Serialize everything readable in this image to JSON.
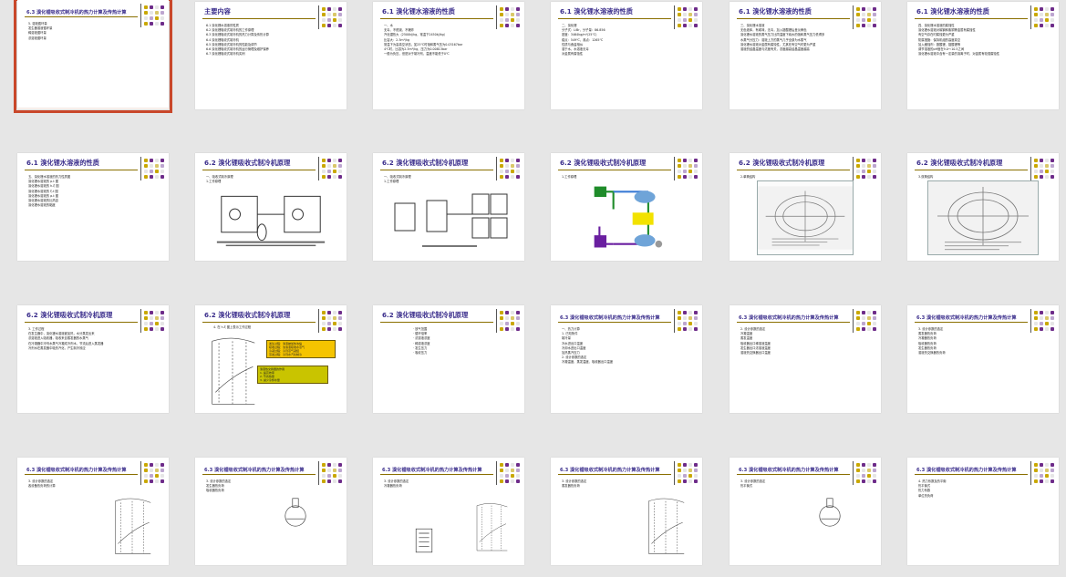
{
  "colors": {
    "background": "#e6e6e6",
    "title": "#3b2e8c",
    "underline": "#8a6f00",
    "selection": "#c9472a",
    "cover": "#b6402a"
  },
  "cover": {
    "title": "制冷原理与设备",
    "chapter": "第六章 溴化锂吸收式制冷",
    "teacher": "主讲教师：张 颖 副教授",
    "school": "中原工学院能源与环境学院"
  },
  "slides": [
    {
      "title": "主要内容",
      "style": "normal",
      "lines": [
        "6.1 溴化锂水溶液的性质",
        "6.2 溴化锂吸收式制冷机的工作原理",
        "6.3 溴化锂吸收式制冷机的热力计算及传热计算",
        "6.4 溴化锂吸收式制冷机",
        "6.5 溴化锂吸收式制冷机的性能及调节",
        "6.6 溴化锂吸收式制冷机的运行管理及维护保养",
        "6.7 溴化锂吸收式制冷机实例"
      ]
    },
    {
      "title": "6.1 溴化锂水溶液的性质",
      "style": "normal",
      "lines": [
        "一、水",
        "无毒、不燃烧、不爆炸",
        "汽化潜热大（2500kJ/kg，常温下2450kJ/kg）",
        "比容大：2.3m³/kg",
        "常温下为高真空状态，如25℃时饱和蒸气压为0.03167bar",
        "4℃时，比容为2.3m³/kg，压力为0.00813bar",
        "一般为负压，但是对于制冷剂，温度不能低于0℃"
      ]
    },
    {
      "title": "6.1 溴化锂水溶液的性质",
      "style": "normal",
      "lines": [
        "二、溴化锂",
        "分子式：LiBr，分子量：86.856",
        "密度：3464kg/m³(25℃)",
        "熔点：549℃，沸点：1265℃",
        "性质与食盐相似",
        "溶于水，水溶液无毒",
        "对金属有腐蚀性"
      ]
    },
    {
      "title": "6.1 溴化锂水溶液的性质",
      "style": "normal",
      "lines": [
        "三、溴化锂水溶液",
        "无色液体，有咸味，无毒，加入铬酸锂后呈淡黄色",
        "溴化锂水溶液的蒸气压力比同温度下纯水的饱和蒸气压力低得多",
        "水蒸气分压力：溶液上方的蒸气几乎全部为水蒸气",
        "溴化锂水溶液对金属有腐蚀性，尤其在有空气时更为严重",
        "溶液的结晶温度与浓度有关，浓度越高结晶温度越高"
      ]
    },
    {
      "title": "6.1 溴化锂水溶液的性质",
      "style": "normal",
      "lines": [
        "四、溴化锂水溶液的腐蚀性",
        "溴化锂水溶液对碳钢和紫铜等金属有腐蚀性",
        "有空气存在时腐蚀更为严重",
        "防腐措施：保持机组的高度真空",
        "加入缓蚀剂：铬酸锂、钼酸锂等",
        "调节溶液的pH值在9.0～10.5之间",
        "溴化锂水溶液中含有一定量的溴离子时，对金属有较强腐蚀性"
      ]
    },
    {
      "title": "6.1 溴化锂水溶液的性质",
      "style": "normal",
      "lines": [
        "五、溴化锂水溶液的热力性质图",
        "溴化锂水溶液的 p-t 图",
        "溴化锂水溶液的 h-ξ 图",
        "溴化锂水溶液的 ξ-t 图",
        "溴化锂水溶液的 ρ-t 图",
        "溴化锂水溶液的比热容",
        "溴化锂水溶液的黏度"
      ]
    },
    {
      "title": "6.2 溴化锂吸收式制冷机原理",
      "style": "fig-circuit",
      "lines": [
        "一、吸收式制冷原理",
        "1.工作原理"
      ]
    },
    {
      "title": "6.2 溴化锂吸收式制冷机原理",
      "style": "fig-units",
      "lines": [
        "一、吸收式制冷原理",
        "1.工作原理"
      ]
    },
    {
      "title": "6.2 溴化锂吸收式制冷机原理",
      "style": "fig-color",
      "lines": [
        "1.工作原理"
      ]
    },
    {
      "title": "6.2 溴化锂吸收式制冷机原理",
      "style": "fig-photo",
      "lines": [
        "2.单筒结构"
      ]
    },
    {
      "title": "6.2 溴化锂吸收式制冷机原理",
      "style": "fig-photo2",
      "lines": [
        "3.双筒结构"
      ]
    },
    {
      "title": "6.2 溴化锂吸收式制冷机原理",
      "style": "normal",
      "lines": [
        "3. 工作过程",
        "在发生器中，溴化锂水溶液被加热，水分蒸发出来",
        "浓溶液进入吸收器，吸收来自蒸发器的水蒸气",
        "在冷凝器中冷剂水蒸气冷凝成冷剂水，节流后进入蒸发器",
        "冷剂水在蒸发器中吸热汽化，产生制冷效应"
      ]
    },
    {
      "title": "6.2 溴化锂吸收式制冷机原理",
      "style": "fig-yellow",
      "lines": [
        "4. 在 h-ξ 图上表示工作过程"
      ],
      "boxes": [
        "发生过程：溶液被加热浓缩",
        "吸收过程：浓溶液吸收水蒸气",
        "冷凝过程：冷剂蒸气凝结",
        "蒸发过程：冷剂水汽化制冷"
      ],
      "boxes2": [
        "溶液热交换器的作用",
        "1. 提高效率",
        "2. 节省热量",
        "3. 减少冷却水量"
      ]
    },
    {
      "title": "6.2 溴化锂吸收式制冷机原理",
      "style": "formula-list",
      "lines": [
        "· 放气范围",
        "· 循环倍率",
        "· 浓溶液浓度",
        "· 稀溶液浓度",
        "· 发生压力",
        "· 吸收压力"
      ]
    },
    {
      "title": "6.3 溴化锂吸收式制冷机的热力计算及传热计算",
      "style": "small",
      "lines": [
        "一、热力计算",
        "1. 已知条件",
        "制冷量",
        "冷水进出口温度",
        "冷却水进出口温度",
        "加热蒸汽压力",
        "2. 设计参数的选定",
        "冷凝温度、蒸发温度、吸收器出口温度"
      ]
    },
    {
      "title": "6.3 溴化锂吸收式制冷机的热力计算及传热计算",
      "style": "small",
      "lines": [
        "2. 设计参数的选定",
        "冷凝温度",
        "蒸发温度",
        "吸收器出口稀溶液温度",
        "发生器出口浓溶液温度",
        "溶液热交换器出口温度"
      ]
    },
    {
      "title": "6.3 溴化锂吸收式制冷机的热力计算及传热计算",
      "style": "small",
      "lines": [
        "3. 设计参数的选定",
        "蒸发器热负荷",
        "冷凝器热负荷",
        "吸收器热负荷",
        "发生器热负荷",
        "溶液热交换器热负荷"
      ]
    },
    {
      "title": "6.3 溴化锂吸收式制冷机的热力计算及传热计算",
      "style": "small-fig",
      "lines": [
        "3. 设计参数的选定",
        "各设备热负荷的计算"
      ]
    },
    {
      "title": "6.3 溴化锂吸收式制冷机的热力计算及传热计算",
      "style": "small-fig",
      "lines": [
        "3. 设计参数的选定",
        "发生器热负荷",
        "吸收器热负荷"
      ]
    },
    {
      "title": "6.3 溴化锂吸收式制冷机的热力计算及传热计算",
      "style": "small-fig",
      "lines": [
        "3. 设计参数的选定",
        "冷凝器热负荷"
      ]
    },
    {
      "title": "6.3 溴化锂吸收式制冷机的热力计算及传热计算",
      "style": "small-fig",
      "lines": [
        "3. 设计参数的选定",
        "蒸发器热负荷"
      ]
    },
    {
      "title": "6.3 溴化锂吸收式制冷机的热力计算及传热计算",
      "style": "small-fig",
      "lines": [
        "3. 设计参数的选定",
        "热平衡式"
      ]
    },
    {
      "title": "6.3 溴化锂吸收式制冷机的热力计算及传热计算",
      "style": "small",
      "lines": [
        "4. 热力系数及热平衡",
        "热平衡式",
        "热力系数",
        "单位热负荷"
      ]
    },
    {
      "title": "6.3 溴化锂吸收式制冷机的热力计算及传热计算",
      "style": "small",
      "lines": [
        "5. 溶液循环量",
        "发生器溶液循环量",
        "稀溶液循环量",
        "浓溶液循环量"
      ]
    }
  ]
}
